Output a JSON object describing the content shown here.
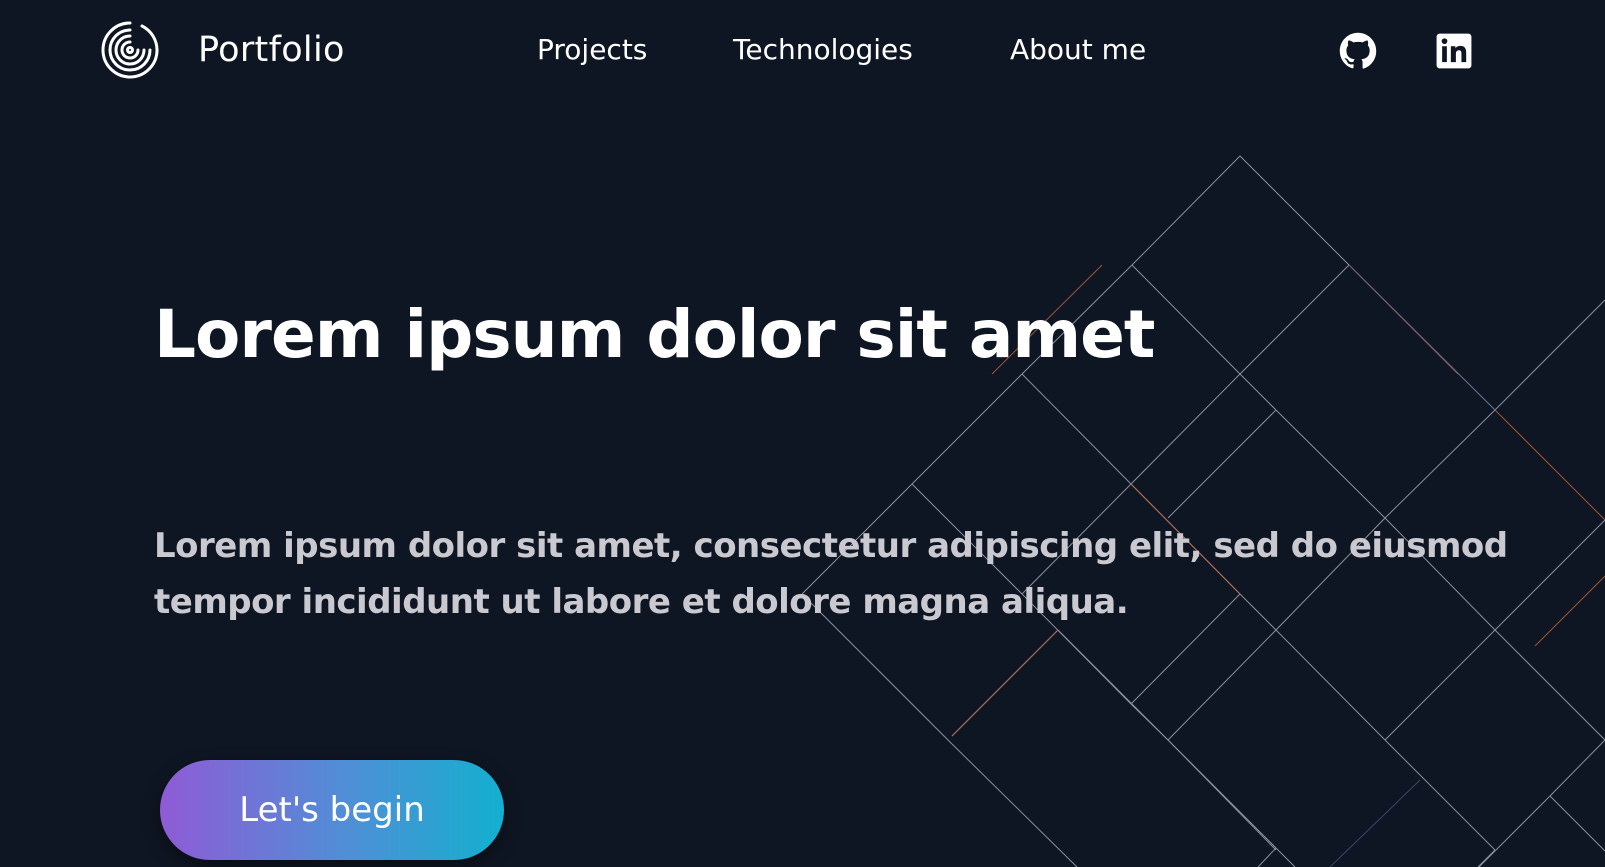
{
  "brand": {
    "name": "Portfolio",
    "logo_icon": "spiral-logo-icon"
  },
  "nav": {
    "items": [
      {
        "label": "Projects"
      },
      {
        "label": "Technologies"
      },
      {
        "label": "About me"
      }
    ],
    "social": [
      {
        "name": "github-icon"
      },
      {
        "name": "linkedin-icon"
      }
    ]
  },
  "hero": {
    "title": "Lorem ipsum dolor sit amet",
    "text": "Lorem ipsum dolor sit amet, consectetur adipiscing elit, sed do eiusmod tempor incididunt ut labore et dolore magna aliqua.",
    "cta_label": "Let's begin"
  },
  "colors": {
    "background": "#0f1623",
    "text_primary": "#ffffff",
    "text_secondary": "#c9c9cf",
    "cta_gradient_start": "#8f5bd6",
    "cta_gradient_end": "#13b0cf",
    "pattern_line": "#8a8f9c",
    "pattern_accent": "#c2643a"
  }
}
